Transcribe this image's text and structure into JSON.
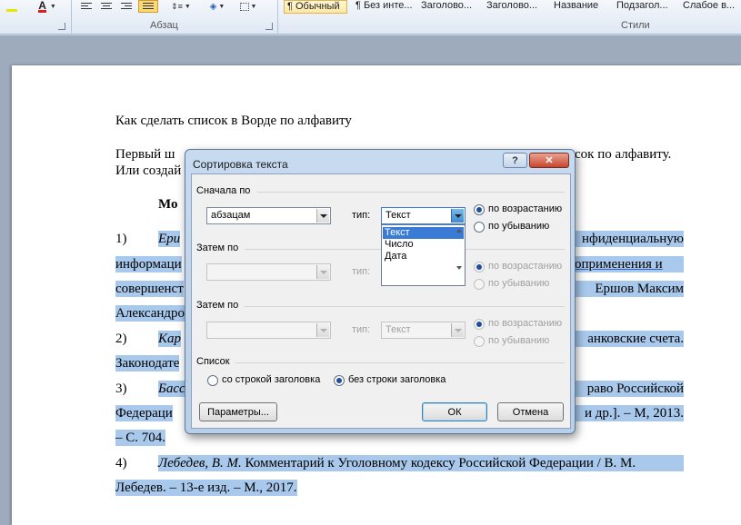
{
  "ribbon": {
    "group_paragraph": "Абзац",
    "group_styles": "Стили",
    "styles": [
      "¶ Обычный",
      "¶ Без инте...",
      "Заголово...",
      "Заголово...",
      "Название",
      "Подзагол...",
      "Слабое в..."
    ]
  },
  "document": {
    "title_line": "Как сделать список в Ворде по алфавиту",
    "para1_a": "Первый ш",
    "para1_b": "сок по алфавиту.",
    "para1_c": "Или создай",
    "heading": "Мо",
    "items": [
      {
        "num": "1)",
        "line1_left": "Ери",
        "line1_right": "нфиденциальную",
        "line2_left": "информаци",
        "line2_right": "оприменения и",
        "line3_left": "совершенст",
        "line3_right": "Ершов Максим",
        "line4_left": "Александро"
      },
      {
        "num": "2)",
        "line1_left": "Кар",
        "line1_right": "анковские счета.",
        "line2_left": "Законодате"
      },
      {
        "num": "3)",
        "line1_left": "Басс",
        "line1_right": "раво Российской",
        "line2_left": "Федераци",
        "line2_right": "и др.]. – М, 2013.",
        "line3_left": "– С. 704."
      },
      {
        "num": "4)",
        "line1_author": "Лебедев, В. М.",
        "line1_rest": "Комментарий к Уголовному кодексу Российской Федерации / В. М.",
        "line2": "Лебедев. – 13-е изд. – М., 2017."
      }
    ]
  },
  "dialog": {
    "title": "Сортировка текста",
    "help_label": "?",
    "close_label": "✕",
    "first_by": {
      "label": "Сначала по",
      "field_value": "абзацам",
      "type_label": "тип:",
      "type_value": "Текст",
      "asc": "по возрастанию",
      "desc": "по убыванию"
    },
    "type_options": [
      "Текст",
      "Число",
      "Дата"
    ],
    "then_by_1": {
      "label": "Затем по",
      "type_label": "тип:",
      "asc": "по возрастанию",
      "desc": "по убыванию"
    },
    "then_by_2": {
      "label": "Затем по",
      "type_label": "тип:",
      "type_value": "Текст",
      "asc": "по возрастанию",
      "desc": "по убыванию"
    },
    "list": {
      "label": "Список",
      "with_header": "со строкой заголовка",
      "without_header": "без строки заголовка"
    },
    "params_button": "Параметры...",
    "ok_button": "ОК",
    "cancel_button": "Отмена"
  }
}
